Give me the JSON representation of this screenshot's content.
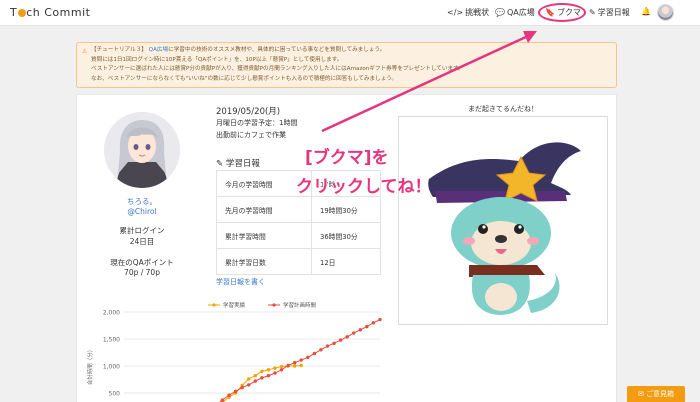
{
  "navbar": {
    "logo_text_1": "T",
    "logo_text_2": "ch Commit",
    "items": [
      {
        "label": "挑戦状",
        "icon": "code-icon"
      },
      {
        "label": "QA広場",
        "icon": "chat-icon"
      },
      {
        "label": "ブクマ",
        "icon": "bookmark-icon"
      },
      {
        "label": "学習日報",
        "icon": "pencil-icon"
      }
    ],
    "bell_icon": "bell-icon"
  },
  "notice": {
    "line1_prefix": "【チュートリアル３】",
    "line1_link": "QA広場",
    "line1_rest": "に学習中の技術のオススメ教材や、具体的に困っている事などを質問してみましょう。",
    "line2": "質問には1日1回ログイン時に10P貰える「QAポイント」を、10P以上「懸賞P」として使用します。",
    "line3": "ベストアンサーに選ばれた人には懸賞P分の貢献Pが入り、獲得貢献Pの月間ランキング入りした人にはAmazonギフト券等をプレゼントしています。",
    "line4": "なお、ベストアンサーにならなくても\"いいね\"の数に応じて少し懸賞ポイントも入るので積極的に回答もしてみましょう。"
  },
  "profile": {
    "name": "ちろる。",
    "handle": "@Chirol",
    "login_label": "累計ログイン",
    "login_value": "24日目",
    "qa_label": "現在のQAポイント",
    "qa_value": "70p / 70p"
  },
  "daily": {
    "date": "2019/05/20(月)",
    "plan": "月曜日の学習予定：1時間",
    "memo": "出勤前にカフェで作業",
    "section_title": "学習日報",
    "rows": [
      {
        "label": "今月の学習時間",
        "value": "17時"
      },
      {
        "label": "先月の学習時間",
        "value": "19時間30分"
      },
      {
        "label": "累計学習時間",
        "value": "36時間30分"
      },
      {
        "label": "累計学習日数",
        "value": "12日"
      }
    ],
    "write_link": "学習日報を書く"
  },
  "mascot": {
    "title": "まだ起きてるんだね！"
  },
  "overlay": {
    "line1": "[ブクマ]を",
    "line2": "クリックしてね！",
    "color": "#e6357e"
  },
  "feedback": {
    "label": "ご意見箱"
  },
  "chart_data": {
    "type": "line",
    "ylabel": "合計時間（分）",
    "ylim": [
      0,
      2000
    ],
    "yticks": [
      "2,000",
      "1,500",
      "1,000",
      "500"
    ],
    "series": [
      {
        "name": "学習実績",
        "color": "#f0a500",
        "values": [
          null,
          null,
          null,
          null,
          null,
          null,
          null,
          null,
          null,
          null,
          null,
          null,
          null,
          180,
          240,
          330,
          420,
          500,
          640,
          760,
          820,
          900,
          930,
          960,
          990,
          1000,
          1000,
          1010
        ]
      },
      {
        "name": "学習計画時間",
        "color": "#e74c3c",
        "values": [
          null,
          null,
          null,
          null,
          null,
          null,
          null,
          null,
          null,
          null,
          null,
          null,
          100,
          190,
          280,
          370,
          460,
          530,
          600,
          650,
          720,
          780,
          820,
          870,
          930,
          1010,
          1060,
          1110,
          1160,
          1230,
          1300,
          1370,
          1420,
          1480,
          1540,
          1610,
          1670,
          1730,
          1800,
          1860
        ]
      }
    ]
  }
}
